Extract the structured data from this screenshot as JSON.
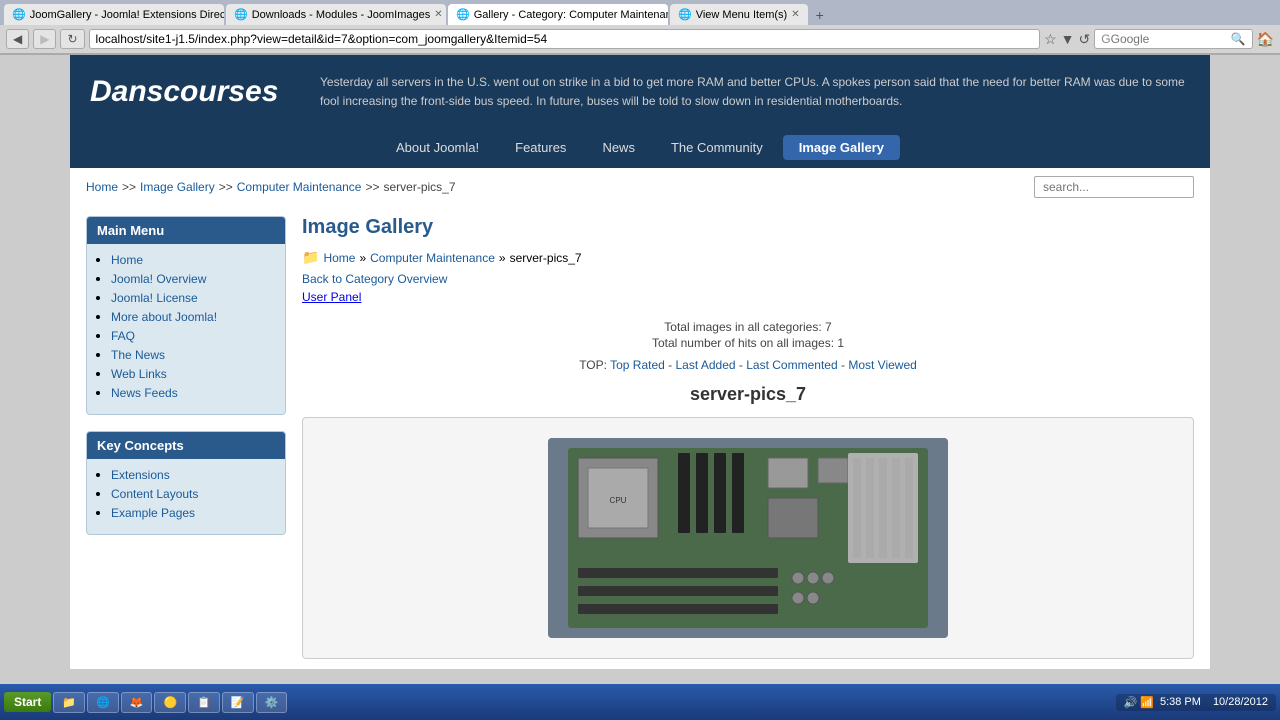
{
  "browser": {
    "tabs": [
      {
        "id": 1,
        "label": "JoomGallery - Joomla! Extensions Directory",
        "icon": "🌐",
        "active": false
      },
      {
        "id": 2,
        "label": "Downloads - Modules - JoomImages",
        "icon": "🌐",
        "active": false
      },
      {
        "id": 3,
        "label": "Gallery - Category: Computer Maintenan...",
        "icon": "🌐",
        "active": true
      },
      {
        "id": 4,
        "label": "View Menu Item(s)",
        "icon": "🌐",
        "active": false
      }
    ],
    "address": "localhost/site1-j1.5/index.php?view=detail&id=7&option=com_joomgallery&Itemid=54",
    "search_placeholder": "Google",
    "back_disabled": false,
    "forward_disabled": false
  },
  "site": {
    "logo": "Danscourses",
    "header_text": "Yesterday all servers in the U.S. went out on strike in a bid to get more RAM and better CPUs. A spokes person said that the need for better RAM was due to some fool increasing the front-side bus speed. In future, buses will be told to slow down in residential motherboards."
  },
  "nav": {
    "items": [
      {
        "id": "about",
        "label": "About Joomla!",
        "active": false
      },
      {
        "id": "features",
        "label": "Features",
        "active": false
      },
      {
        "id": "news",
        "label": "News",
        "active": false
      },
      {
        "id": "community",
        "label": "The Community",
        "active": false
      },
      {
        "id": "gallery",
        "label": "Image Gallery",
        "active": true
      }
    ]
  },
  "breadcrumb": {
    "items": [
      {
        "label": "Home",
        "href": "#"
      },
      {
        "label": "Image Gallery",
        "href": "#"
      },
      {
        "label": "Computer Maintenance",
        "href": "#"
      },
      {
        "label": "server-pics_7",
        "href": "#"
      }
    ],
    "search_placeholder": "search..."
  },
  "sidebar": {
    "main_menu": {
      "title": "Main Menu",
      "items": [
        {
          "label": "Home",
          "href": "#"
        },
        {
          "label": "Joomla! Overview",
          "href": "#"
        },
        {
          "label": "Joomla! License",
          "href": "#"
        },
        {
          "label": "More about Joomla!",
          "href": "#"
        },
        {
          "label": "FAQ",
          "href": "#"
        },
        {
          "label": "The News",
          "href": "#"
        },
        {
          "label": "Web Links",
          "href": "#"
        },
        {
          "label": "News Feeds",
          "href": "#"
        }
      ]
    },
    "key_concepts": {
      "title": "Key Concepts",
      "items": [
        {
          "label": "Extensions",
          "href": "#"
        },
        {
          "label": "Content Layouts",
          "href": "#"
        },
        {
          "label": "Example Pages",
          "href": "#"
        }
      ]
    }
  },
  "content": {
    "page_title": "Image Gallery",
    "breadcrumb_path": {
      "icon": "📁",
      "parts": [
        {
          "label": "Home",
          "href": "#"
        },
        {
          "label": "Computer Maintenance",
          "href": "#"
        },
        {
          "label": "server-pics_7",
          "href": "#"
        }
      ]
    },
    "back_link": "Back to Category Overview",
    "user_panel_link": "User Panel",
    "stats": {
      "total_images": "Total images in all categories: 7",
      "total_hits": "Total number of hits on all images: 1"
    },
    "top_label": "TOP:",
    "top_links": [
      {
        "label": "Top Rated",
        "href": "#"
      },
      {
        "label": "Last Added",
        "href": "#"
      },
      {
        "label": "Last Commented",
        "href": "#"
      },
      {
        "label": "Most Viewed",
        "href": "#"
      }
    ],
    "gallery_name": "server-pics_7"
  },
  "taskbar": {
    "start_label": "Start",
    "items": [
      {
        "label": "Start",
        "icon": "🪟",
        "active": false
      },
      {
        "label": "",
        "icon": "📁",
        "active": false
      },
      {
        "label": "",
        "icon": "🌐",
        "active": false
      },
      {
        "label": "",
        "icon": "🦊",
        "active": false
      },
      {
        "label": "",
        "icon": "🟡",
        "active": false
      },
      {
        "label": "",
        "icon": "📋",
        "active": false
      },
      {
        "label": "",
        "icon": "📝",
        "active": false
      },
      {
        "label": "",
        "icon": "⚙️",
        "active": false
      }
    ],
    "time": "5:38 PM",
    "date": "10/28/2012"
  }
}
